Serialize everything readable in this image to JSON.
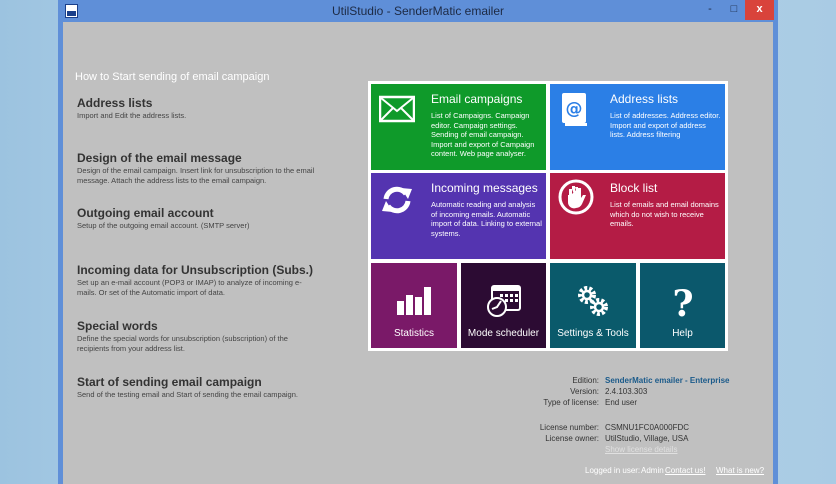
{
  "window": {
    "title": "UtilStudio - SenderMatic emailer",
    "minimize": "-",
    "maximize": "□",
    "close": "x"
  },
  "howto": {
    "heading": "How to Start sending of email campaign",
    "steps": [
      {
        "title": "Address lists",
        "desc": "Import and Edit the address lists."
      },
      {
        "title": "Design of the email message",
        "desc": "Design of the email campaign. Insert link for unsubscription to the email message. Attach the address lists to the email campaign."
      },
      {
        "title": "Outgoing email account",
        "desc": "Setup of the outgoing email account. (SMTP server)"
      },
      {
        "title": "Incoming data for Unsubscription (Subs.)",
        "desc": "Set up an e-mail account (POP3 or IMAP) to analyze of incoming e-mails. Or set of the Automatic import of data."
      },
      {
        "title": "Special words",
        "desc": "Define the special words for unsubscription (subscription) of the recipients from your address list."
      },
      {
        "title": "Start of sending email campaign",
        "desc": "Send of the testing email and Start of sending the email campaign."
      }
    ]
  },
  "tiles": [
    {
      "title": "Email campaigns",
      "desc": "List of Campaigns. Campaign editor. Campaign settings. Sending of email campaign. Import and export of Campaign content. Web page analyser.",
      "color": "#0f9a2a",
      "icon": "envelope-icon"
    },
    {
      "title": "Address lists",
      "desc": "List of addresses. Address editor. Import and export of address lists. Address filtering",
      "color": "#2b7fe6",
      "icon": "address-book-icon"
    },
    {
      "title": "Incoming messages",
      "desc": "Automatic reading and analysis of incoming emails. Automatic import of data. Linking to external systems.",
      "color": "#5434b0",
      "icon": "refresh-icon"
    },
    {
      "title": "Block list",
      "desc": "List of emails and email domains which do not wish to receive emails.",
      "color": "#b41c45",
      "icon": "hand-stop-icon"
    }
  ],
  "small_tiles": [
    {
      "label": "Statistics",
      "color": "#7a1968",
      "icon": "bar-chart-icon"
    },
    {
      "label": "Mode scheduler",
      "color": "#2c0b33",
      "icon": "calendar-clock-icon"
    },
    {
      "label": "Settings & Tools",
      "color": "#0a5a6b",
      "icon": "gears-icon"
    },
    {
      "label": "Help",
      "color": "#0b586c",
      "icon": "question-icon"
    }
  ],
  "license": {
    "edition_label": "Edition:",
    "edition": "SenderMatic emailer - Enterprise",
    "version_label": "Version:",
    "version": "2.4.103.303",
    "type_label": "Type of license:",
    "type": "End user",
    "number_label": "License number:",
    "number": "CSMNU1FC0A000FDC",
    "owner_label": "License owner:",
    "owner": "UtilStudio, Village, USA",
    "details_link": "Show license details"
  },
  "footer": {
    "logged_label": "Logged in user:",
    "user": "Admin",
    "contact": "Contact us!",
    "whats_new": "What is new?"
  }
}
